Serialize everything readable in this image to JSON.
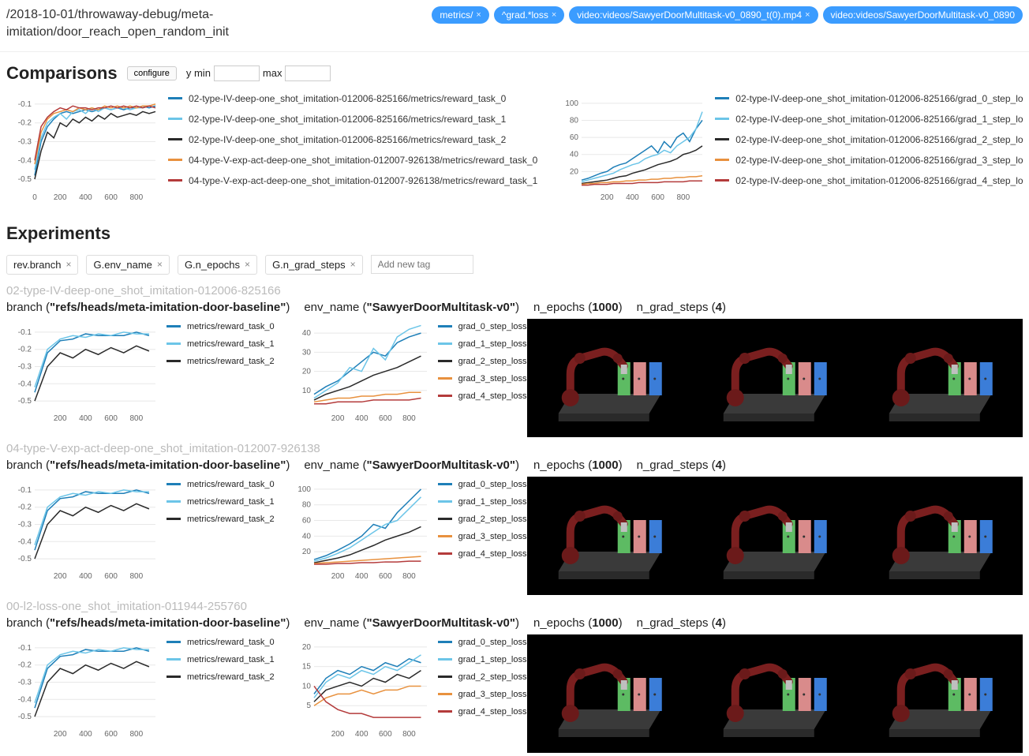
{
  "breadcrumb": "/2018-10-01/throwaway-debug/meta-imitation/door_reach_open_random_init",
  "filter_chips": [
    {
      "label": "metrics/",
      "close": "×"
    },
    {
      "label": "^grad.*loss",
      "close": "×"
    },
    {
      "label": "video:videos/SawyerDoorMultitask-v0_0890_t(0).mp4",
      "close": "×"
    },
    {
      "label": "video:videos/SawyerDoorMultitask-v0_0890",
      "close": ""
    }
  ],
  "comparisons": {
    "title": "Comparisons",
    "configure": "configure",
    "ymin_label": "y min",
    "ymax_label": "max"
  },
  "comp_legend_left": [
    {
      "color": "#1e7fb8",
      "label": "02-type-IV-deep-one_shot_imitation-012006-825166/metrics/reward_task_0"
    },
    {
      "color": "#6cc5e8",
      "label": "02-type-IV-deep-one_shot_imitation-012006-825166/metrics/reward_task_1"
    },
    {
      "color": "#2a2a2a",
      "label": "02-type-IV-deep-one_shot_imitation-012006-825166/metrics/reward_task_2"
    },
    {
      "color": "#e8913e",
      "label": "04-type-V-exp-act-deep-one_shot_imitation-012007-926138/metrics/reward_task_0"
    },
    {
      "color": "#b43b3b",
      "label": "04-type-V-exp-act-deep-one_shot_imitation-012007-926138/metrics/reward_task_1"
    }
  ],
  "comp_legend_right": [
    {
      "color": "#1e7fb8",
      "label": "02-type-IV-deep-one_shot_imitation-012006-825166/grad_0_step_lo"
    },
    {
      "color": "#6cc5e8",
      "label": "02-type-IV-deep-one_shot_imitation-012006-825166/grad_1_step_lo"
    },
    {
      "color": "#2a2a2a",
      "label": "02-type-IV-deep-one_shot_imitation-012006-825166/grad_2_step_lo"
    },
    {
      "color": "#e8913e",
      "label": "02-type-IV-deep-one_shot_imitation-012006-825166/grad_3_step_lo"
    },
    {
      "color": "#b43b3b",
      "label": "02-type-IV-deep-one_shot_imitation-012006-825166/grad_4_step_lo"
    }
  ],
  "experiments_title": "Experiments",
  "tags": [
    {
      "label": "rev.branch"
    },
    {
      "label": "G.env_name"
    },
    {
      "label": "G.n_epochs"
    },
    {
      "label": "G.n_grad_steps"
    }
  ],
  "tag_placeholder": "Add new tag",
  "experiments": [
    {
      "id": "02-type-IV-deep-one_shot_imitation-012006-825166",
      "branch": "\"refs/heads/meta-imitation-door-baseline\"",
      "env_name": "\"SawyerDoorMultitask-v0\"",
      "n_epochs": "1000",
      "n_grad_steps": "4"
    },
    {
      "id": "04-type-V-exp-act-deep-one_shot_imitation-012007-926138",
      "branch": "\"refs/heads/meta-imitation-door-baseline\"",
      "env_name": "\"SawyerDoorMultitask-v0\"",
      "n_epochs": "1000",
      "n_grad_steps": "4"
    },
    {
      "id": "00-l2-loss-one_shot_imitation-011944-255760",
      "branch": "\"refs/heads/meta-imitation-door-baseline\"",
      "env_name": "\"SawyerDoorMultitask-v0\"",
      "n_epochs": "1000",
      "n_grad_steps": "4"
    }
  ],
  "reward_legend": [
    {
      "color": "#1e7fb8",
      "label": "metrics/reward_task_0"
    },
    {
      "color": "#6cc5e8",
      "label": "metrics/reward_task_1"
    },
    {
      "color": "#2a2a2a",
      "label": "metrics/reward_task_2"
    }
  ],
  "grad_legend": [
    {
      "color": "#1e7fb8",
      "label": "grad_0_step_loss"
    },
    {
      "color": "#6cc5e8",
      "label": "grad_1_step_loss"
    },
    {
      "color": "#2a2a2a",
      "label": "grad_2_step_loss"
    },
    {
      "color": "#e8913e",
      "label": "grad_3_step_loss"
    },
    {
      "color": "#b43b3b",
      "label": "grad_4_step_loss"
    }
  ],
  "chart_data": [
    {
      "type": "line",
      "title": "Comparison reward_task",
      "xlabel": "",
      "ylabel": "",
      "x_ticks": [
        0,
        200,
        400,
        600,
        800
      ],
      "y_ticks": [
        -0.5,
        -0.4,
        -0.3,
        -0.2,
        -0.1
      ],
      "xlim": [
        0,
        950
      ],
      "ylim": [
        -0.55,
        -0.05
      ],
      "x": [
        0,
        50,
        100,
        150,
        200,
        250,
        300,
        350,
        400,
        450,
        500,
        550,
        600,
        650,
        700,
        750,
        800,
        850,
        900,
        950
      ],
      "series": [
        {
          "name": "02/reward_task_0",
          "color": "#1e7fb8",
          "values": [
            -0.48,
            -0.3,
            -0.22,
            -0.18,
            -0.15,
            -0.14,
            -0.15,
            -0.14,
            -0.13,
            -0.14,
            -0.13,
            -0.12,
            -0.13,
            -0.12,
            -0.13,
            -0.12,
            -0.12,
            -0.11,
            -0.12,
            -0.11
          ]
        },
        {
          "name": "02/reward_task_1",
          "color": "#6cc5e8",
          "values": [
            -0.45,
            -0.28,
            -0.2,
            -0.17,
            -0.15,
            -0.18,
            -0.14,
            -0.13,
            -0.15,
            -0.12,
            -0.14,
            -0.12,
            -0.13,
            -0.12,
            -0.12,
            -0.13,
            -0.12,
            -0.12,
            -0.11,
            -0.12
          ]
        },
        {
          "name": "02/reward_task_2",
          "color": "#2a2a2a",
          "values": [
            -0.5,
            -0.35,
            -0.25,
            -0.28,
            -0.2,
            -0.22,
            -0.18,
            -0.2,
            -0.17,
            -0.19,
            -0.16,
            -0.18,
            -0.15,
            -0.17,
            -0.16,
            -0.15,
            -0.16,
            -0.14,
            -0.15,
            -0.14
          ]
        },
        {
          "name": "04/reward_task_0",
          "color": "#e8913e",
          "values": [
            -0.42,
            -0.25,
            -0.18,
            -0.15,
            -0.14,
            -0.13,
            -0.14,
            -0.12,
            -0.13,
            -0.12,
            -0.13,
            -0.11,
            -0.12,
            -0.11,
            -0.12,
            -0.11,
            -0.12,
            -0.11,
            -0.11,
            -0.1
          ]
        },
        {
          "name": "04/reward_task_1",
          "color": "#b43b3b",
          "values": [
            -0.4,
            -0.22,
            -0.17,
            -0.14,
            -0.12,
            -0.13,
            -0.11,
            -0.12,
            -0.12,
            -0.13,
            -0.12,
            -0.12,
            -0.11,
            -0.12,
            -0.11,
            -0.12,
            -0.11,
            -0.12,
            -0.11,
            -0.12
          ]
        }
      ]
    },
    {
      "type": "line",
      "title": "Comparison grad_step_loss",
      "xlabel": "",
      "ylabel": "",
      "x_ticks": [
        200,
        400,
        600,
        800
      ],
      "y_ticks": [
        20,
        40,
        60,
        80,
        100
      ],
      "xlim": [
        0,
        950
      ],
      "ylim": [
        0,
        110
      ],
      "x": [
        0,
        50,
        100,
        150,
        200,
        250,
        300,
        350,
        400,
        450,
        500,
        550,
        600,
        650,
        700,
        750,
        800,
        850,
        900,
        950
      ],
      "series": [
        {
          "name": "grad_0",
          "color": "#1e7fb8",
          "values": [
            10,
            12,
            15,
            18,
            20,
            25,
            28,
            30,
            35,
            40,
            45,
            50,
            42,
            55,
            48,
            60,
            65,
            55,
            70,
            80
          ]
        },
        {
          "name": "grad_1",
          "color": "#6cc5e8",
          "values": [
            8,
            10,
            12,
            14,
            16,
            18,
            22,
            25,
            28,
            30,
            35,
            38,
            40,
            45,
            42,
            50,
            55,
            60,
            70,
            90
          ]
        },
        {
          "name": "grad_2",
          "color": "#2a2a2a",
          "values": [
            6,
            7,
            8,
            9,
            10,
            12,
            14,
            15,
            18,
            20,
            22,
            25,
            28,
            30,
            32,
            35,
            40,
            42,
            45,
            50
          ]
        },
        {
          "name": "grad_3",
          "color": "#e8913e",
          "values": [
            5,
            6,
            6,
            7,
            7,
            8,
            8,
            9,
            9,
            10,
            10,
            11,
            11,
            12,
            12,
            13,
            13,
            14,
            14,
            15
          ]
        },
        {
          "name": "grad_4",
          "color": "#b43b3b",
          "values": [
            4,
            4,
            5,
            5,
            5,
            6,
            6,
            6,
            6,
            7,
            7,
            7,
            7,
            8,
            8,
            8,
            8,
            9,
            9,
            9
          ]
        }
      ]
    },
    {
      "type": "line",
      "title": "exp reward (small)",
      "xlabel": "",
      "ylabel": "",
      "x_ticks": [
        200,
        400,
        600,
        800
      ],
      "y_ticks": [
        -0.5,
        -0.4,
        -0.3,
        -0.2,
        -0.1
      ],
      "xlim": [
        0,
        950
      ],
      "ylim": [
        -0.55,
        -0.05
      ],
      "x": [
        0,
        100,
        200,
        300,
        400,
        500,
        600,
        700,
        800,
        900
      ],
      "series": [
        {
          "name": "reward_task_0",
          "color": "#1e7fb8",
          "values": [
            -0.45,
            -0.22,
            -0.15,
            -0.14,
            -0.11,
            -0.12,
            -0.12,
            -0.12,
            -0.1,
            -0.12
          ]
        },
        {
          "name": "reward_task_1",
          "color": "#6cc5e8",
          "values": [
            -0.42,
            -0.2,
            -0.14,
            -0.12,
            -0.13,
            -0.11,
            -0.12,
            -0.1,
            -0.11,
            -0.11
          ]
        },
        {
          "name": "reward_task_2",
          "color": "#2a2a2a",
          "values": [
            -0.5,
            -0.3,
            -0.22,
            -0.25,
            -0.2,
            -0.23,
            -0.19,
            -0.22,
            -0.18,
            -0.21
          ]
        }
      ]
    },
    {
      "type": "line",
      "title": "exp grad (small)",
      "xlabel": "",
      "ylabel": "",
      "x_ticks": [
        200,
        400,
        600,
        800
      ],
      "y_ticks": [
        10,
        20,
        30,
        40
      ],
      "xlim": [
        0,
        950
      ],
      "ylim": [
        0,
        45
      ],
      "x": [
        0,
        100,
        200,
        300,
        400,
        500,
        600,
        700,
        800,
        900
      ],
      "series": [
        {
          "name": "grad_0",
          "color": "#1e7fb8",
          "values": [
            8,
            12,
            15,
            20,
            25,
            30,
            28,
            35,
            38,
            40
          ]
        },
        {
          "name": "grad_1",
          "color": "#6cc5e8",
          "values": [
            6,
            10,
            14,
            22,
            20,
            32,
            26,
            38,
            42,
            44
          ]
        },
        {
          "name": "grad_2",
          "color": "#2a2a2a",
          "values": [
            5,
            8,
            10,
            12,
            15,
            18,
            20,
            22,
            25,
            28
          ]
        },
        {
          "name": "grad_3",
          "color": "#e8913e",
          "values": [
            4,
            5,
            6,
            6,
            7,
            7,
            8,
            8,
            9,
            9
          ]
        },
        {
          "name": "grad_4",
          "color": "#b43b3b",
          "values": [
            3,
            3,
            4,
            4,
            4,
            5,
            5,
            5,
            5,
            6
          ]
        }
      ]
    },
    {
      "type": "line",
      "title": "exp04 grad (small)",
      "xlabel": "",
      "ylabel": "",
      "x_ticks": [
        200,
        400,
        600,
        800
      ],
      "y_ticks": [
        20,
        40,
        60,
        80,
        100
      ],
      "xlim": [
        0,
        950
      ],
      "ylim": [
        0,
        110
      ],
      "x": [
        0,
        100,
        200,
        300,
        400,
        500,
        600,
        700,
        800,
        900
      ],
      "series": [
        {
          "name": "grad_0",
          "color": "#1e7fb8",
          "values": [
            10,
            15,
            22,
            30,
            40,
            55,
            50,
            70,
            85,
            100
          ]
        },
        {
          "name": "grad_1",
          "color": "#6cc5e8",
          "values": [
            8,
            12,
            18,
            25,
            35,
            45,
            55,
            60,
            75,
            90
          ]
        },
        {
          "name": "grad_2",
          "color": "#2a2a2a",
          "values": [
            6,
            9,
            12,
            16,
            22,
            28,
            35,
            40,
            45,
            52
          ]
        },
        {
          "name": "grad_3",
          "color": "#e8913e",
          "values": [
            5,
            6,
            7,
            8,
            9,
            10,
            11,
            12,
            13,
            14
          ]
        },
        {
          "name": "grad_4",
          "color": "#b43b3b",
          "values": [
            4,
            4,
            5,
            5,
            6,
            6,
            7,
            7,
            8,
            8
          ]
        }
      ]
    },
    {
      "type": "line",
      "title": "exp00 grad (small)",
      "xlabel": "",
      "ylabel": "",
      "x_ticks": [
        200,
        400,
        600,
        800
      ],
      "y_ticks": [
        5,
        10,
        15,
        20
      ],
      "xlim": [
        0,
        950
      ],
      "ylim": [
        0,
        22
      ],
      "x": [
        0,
        100,
        200,
        300,
        400,
        500,
        600,
        700,
        800,
        900
      ],
      "series": [
        {
          "name": "grad_0",
          "color": "#1e7fb8",
          "values": [
            8,
            12,
            14,
            13,
            15,
            14,
            16,
            15,
            17,
            16
          ]
        },
        {
          "name": "grad_1",
          "color": "#6cc5e8",
          "values": [
            7,
            11,
            13,
            12,
            14,
            13,
            15,
            14,
            16,
            18
          ]
        },
        {
          "name": "grad_2",
          "color": "#2a2a2a",
          "values": [
            6,
            9,
            10,
            11,
            10,
            12,
            11,
            13,
            12,
            14
          ]
        },
        {
          "name": "grad_3",
          "color": "#e8913e",
          "values": [
            5,
            7,
            8,
            8,
            9,
            8,
            9,
            9,
            10,
            10
          ]
        },
        {
          "name": "grad_4",
          "color": "#b43b3b",
          "values": [
            10,
            6,
            4,
            3,
            3,
            2,
            2,
            2,
            2,
            2
          ]
        }
      ]
    }
  ]
}
